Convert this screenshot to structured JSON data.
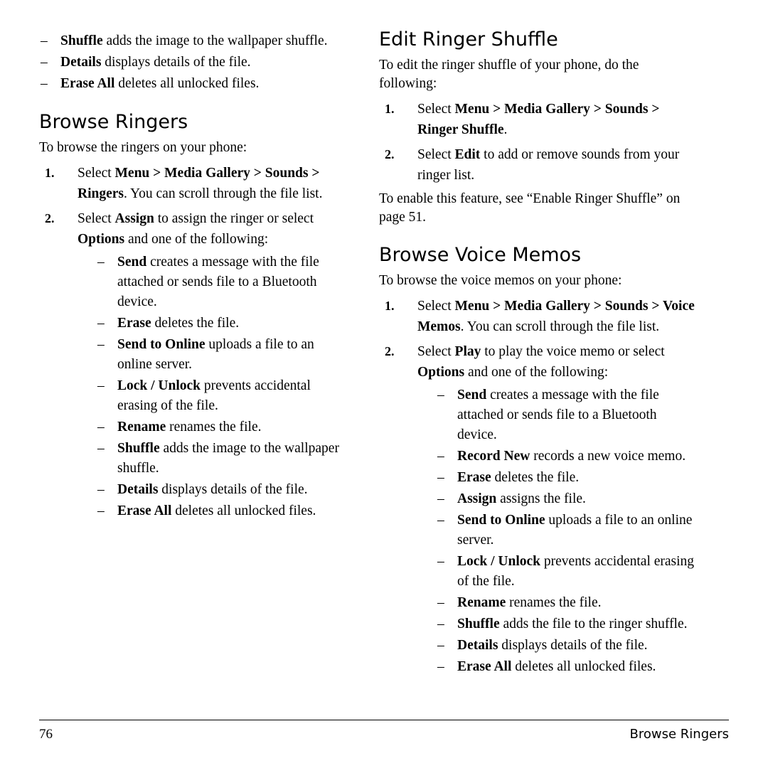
{
  "page": {
    "number": "76",
    "running_head": "Browse Ringers"
  },
  "left_column": {
    "top_list": [
      {
        "term": "Shuffle",
        "text": " adds the image to the wallpaper shuffle."
      },
      {
        "term": "Details",
        "text": " displays details of the file."
      },
      {
        "term": "Erase All",
        "text": " deletes all unlocked files."
      }
    ],
    "section": {
      "heading": "Browse Ringers",
      "intro": "To browse the ringers on your phone:",
      "step1": {
        "num": "1.",
        "pre": "Select ",
        "path": "Menu > Media Gallery > Sounds > Ringers",
        "post": ". You can scroll through the file list."
      },
      "step2": {
        "num": "2.",
        "pre": "Select ",
        "bold1": "Assign",
        "mid": " to assign the ringer or select ",
        "bold2": "Options",
        "post": " and one of the following:",
        "options": [
          {
            "term": "Send",
            "text": " creates a message with the file attached or sends file to a Bluetooth device."
          },
          {
            "term": "Erase",
            "text": " deletes the file."
          },
          {
            "term": "Send to Online",
            "text": " uploads a file to an online server."
          },
          {
            "term": "Lock / Unlock",
            "text": " prevents accidental erasing of the file."
          },
          {
            "term": "Rename",
            "text": " renames the file."
          },
          {
            "term": "Shuffle",
            "text": " adds the image to the wallpaper shuffle."
          },
          {
            "term": "Details",
            "text": " displays details of the file."
          },
          {
            "term": "Erase All",
            "text": " deletes all unlocked files."
          }
        ]
      }
    }
  },
  "right_column": {
    "section1": {
      "heading": "Edit Ringer Shuffle",
      "intro": "To edit the ringer shuffle of your phone, do the following:",
      "step1": {
        "num": "1.",
        "pre": "Select ",
        "path": "Menu > Media Gallery > Sounds > Ringer Shuffle",
        "post": "."
      },
      "step2": {
        "num": "2.",
        "pre": "Select ",
        "bold1": "Edit",
        "post": " to add or remove sounds from your ringer list."
      },
      "outro": "To enable this feature, see “Enable Ringer Shuffle” on page 51."
    },
    "section2": {
      "heading": "Browse Voice Memos",
      "intro": "To browse the voice memos on your phone:",
      "step1": {
        "num": "1.",
        "pre": "Select ",
        "path": "Menu > Media Gallery > Sounds > Voice Memos",
        "post": ". You can scroll through the file list."
      },
      "step2": {
        "num": "2.",
        "pre": "Select ",
        "bold1": "Play",
        "mid": " to play the voice memo or select ",
        "bold2": "Options",
        "post": " and one of the following:",
        "options": [
          {
            "term": "Send",
            "text": " creates a message with the file attached or sends file to a Bluetooth device."
          },
          {
            "term": "Record New",
            "text": " records a new voice memo."
          },
          {
            "term": "Erase",
            "text": " deletes the file."
          },
          {
            "term": "Assign",
            "text": " assigns the file."
          },
          {
            "term": "Send to Online",
            "text": " uploads a file to an online server."
          },
          {
            "term": "Lock / Unlock",
            "text": " prevents accidental erasing of the file."
          },
          {
            "term": "Rename",
            "text": " renames the file."
          },
          {
            "term": "Shuffle",
            "text": " adds the file to the ringer shuffle."
          },
          {
            "term": "Details",
            "text": " displays details of the file."
          },
          {
            "term": "Erase All",
            "text": " deletes all unlocked files."
          }
        ]
      }
    }
  },
  "symbols": {
    "dash": "–"
  }
}
